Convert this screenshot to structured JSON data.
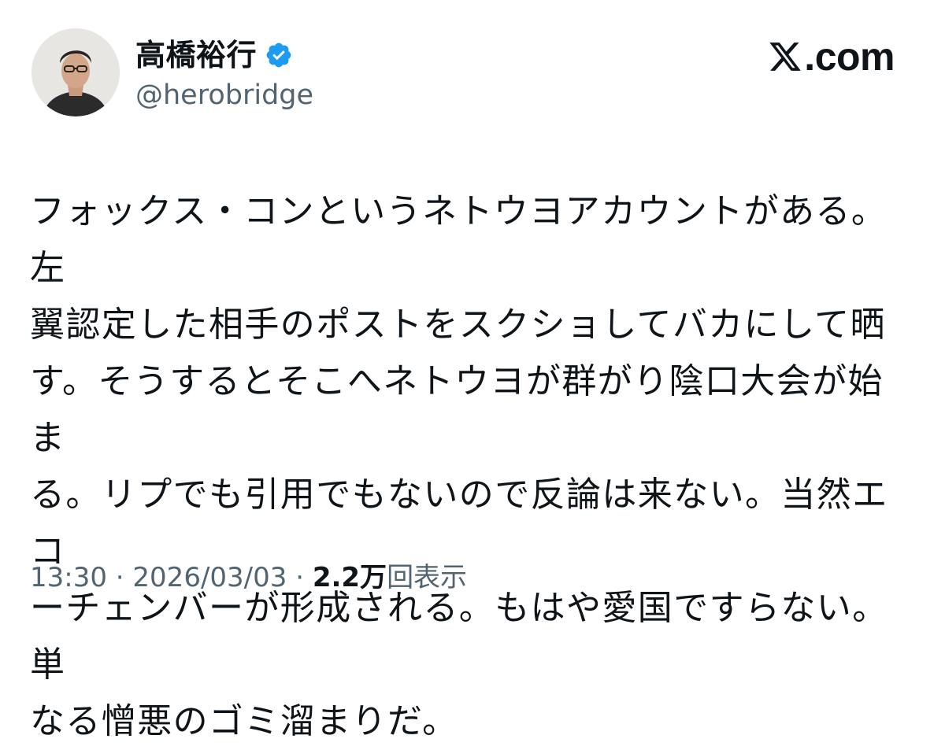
{
  "author": {
    "display_name": "高橋裕行",
    "handle": "@herobridge",
    "verified": true,
    "verified_color": "#1d9bf0",
    "avatar_icon": "user-photo-avatar"
  },
  "brand": {
    "icon": "x-logo-icon",
    "text": ".com"
  },
  "post": {
    "lines": [
      "フォックス・コンというネトウヨアカウントがある。左",
      "翼認定した相手のポストをスクショしてバカにして晒",
      "す。そうするとそこへネトウヨが群がり陰口大会が始ま",
      "る。リプでも引用でもないので反論は来ない。当然エコ",
      "ーチェンバーが形成される。もはや愛国ですらない。単",
      "なる憎悪のゴミ溜まりだ。"
    ]
  },
  "meta": {
    "time": "13:30",
    "separator": " · ",
    "date": "2026/03/03",
    "views_count": "2.2万",
    "views_label": "回表示"
  },
  "colors": {
    "text": "#0f1419",
    "secondary": "#536471",
    "background": "#ffffff"
  }
}
